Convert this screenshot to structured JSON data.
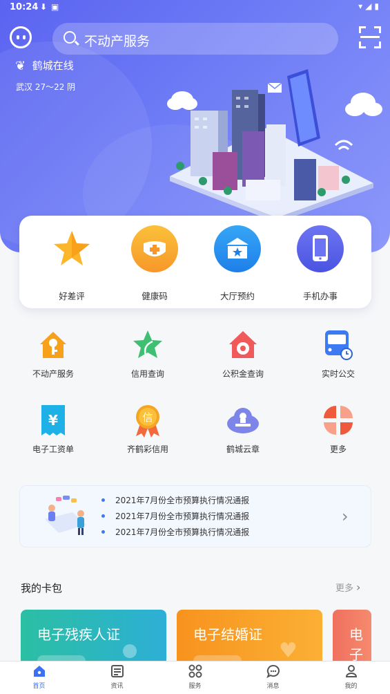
{
  "status_bar": {
    "time": "10:24"
  },
  "search": {
    "placeholder": "不动产服务"
  },
  "brand": {
    "name": "鹤城在线"
  },
  "weather": {
    "text": "武汉 27～22 阴"
  },
  "quick_actions": [
    {
      "label": "好差评",
      "icon": "star-icon"
    },
    {
      "label": "健康码",
      "icon": "mask-icon"
    },
    {
      "label": "大厅预约",
      "icon": "hall-icon"
    },
    {
      "label": "手机办事",
      "icon": "phone-icon"
    }
  ],
  "services": [
    {
      "label": "不动产服务",
      "icon": "house-key-icon"
    },
    {
      "label": "信用查询",
      "icon": "green-star-icon"
    },
    {
      "label": "公积金查询",
      "icon": "house-coin-icon"
    },
    {
      "label": "实时公交",
      "icon": "bus-icon"
    },
    {
      "label": "电子工资单",
      "icon": "salary-receipt-icon"
    },
    {
      "label": "齐鹤彩信用",
      "icon": "credit-medal-icon"
    },
    {
      "label": "鹤城云章",
      "icon": "cloud-seal-icon"
    },
    {
      "label": "更多",
      "icon": "more-grid-icon"
    }
  ],
  "notices": [
    "2021年7月份全市预算执行情况通报",
    "2021年7月份全市预算执行情况通报",
    "2021年7月份全市预算执行情况通报"
  ],
  "wallet": {
    "title": "我的卡包",
    "more": "更多",
    "cards": [
      {
        "title": "电子残疾人证",
        "color": "#2bbfa3"
      },
      {
        "title": "电子结婚证",
        "color": "#f79a1f"
      },
      {
        "title": "电子",
        "color": "#f0705e"
      }
    ]
  },
  "tabs": [
    {
      "label": "首页",
      "active": true
    },
    {
      "label": "资讯"
    },
    {
      "label": "服务"
    },
    {
      "label": "消息"
    },
    {
      "label": "我的"
    }
  ],
  "colors": {
    "primary": "#5a63f0",
    "accent": "#3d6ff2"
  }
}
